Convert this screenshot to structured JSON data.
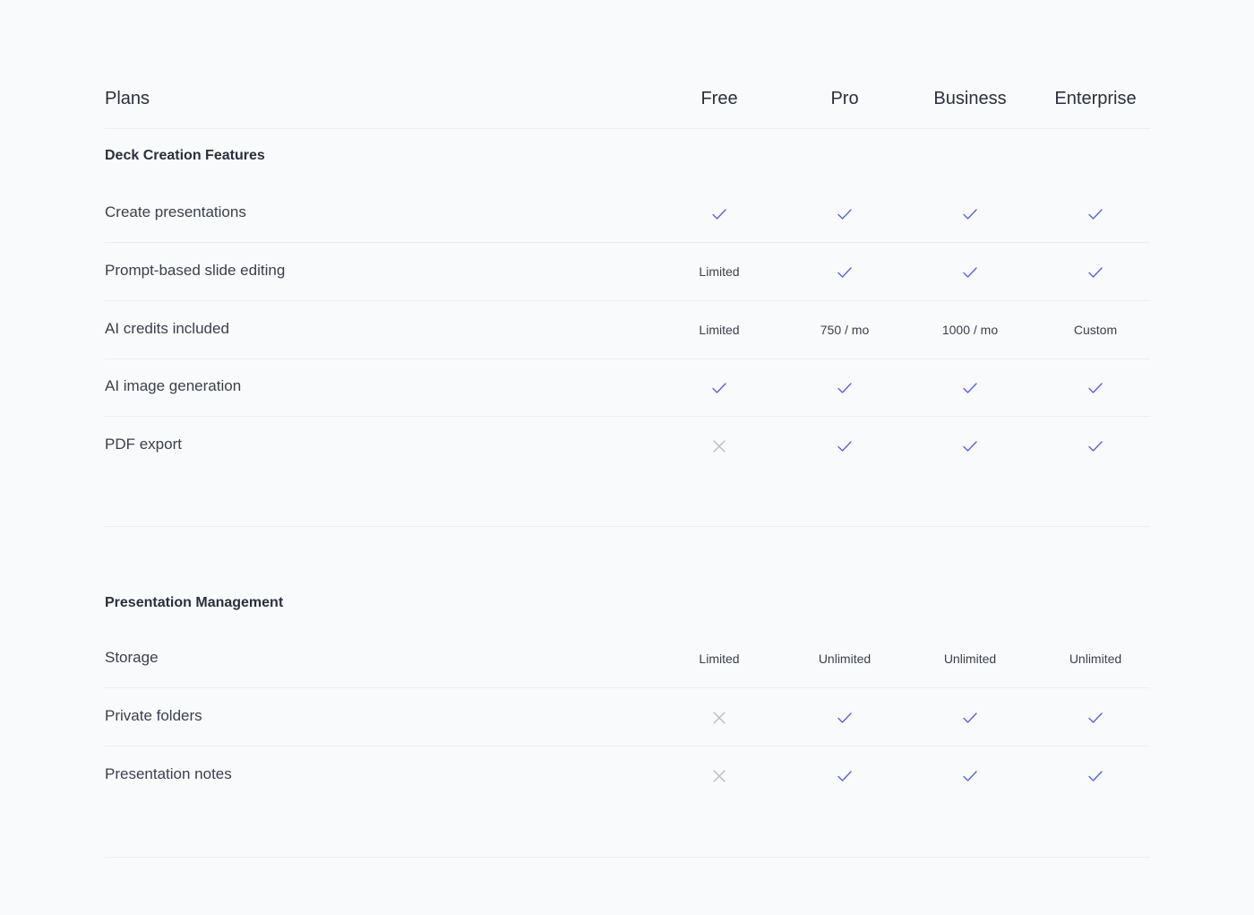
{
  "header": {
    "plans_label": "Plans",
    "plans": [
      "Free",
      "Pro",
      "Business",
      "Enterprise"
    ]
  },
  "sections": [
    {
      "title": "Deck Creation Features",
      "rows": [
        {
          "feature": "Create presentations",
          "cells": [
            {
              "type": "check"
            },
            {
              "type": "check"
            },
            {
              "type": "check"
            },
            {
              "type": "check"
            }
          ]
        },
        {
          "feature": "Prompt-based slide editing",
          "cells": [
            {
              "type": "text",
              "value": "Limited"
            },
            {
              "type": "check"
            },
            {
              "type": "check"
            },
            {
              "type": "check"
            }
          ]
        },
        {
          "feature": "AI credits included",
          "cells": [
            {
              "type": "text",
              "value": "Limited"
            },
            {
              "type": "text",
              "value": "750 / mo"
            },
            {
              "type": "text",
              "value": "1000 / mo"
            },
            {
              "type": "text",
              "value": "Custom"
            }
          ]
        },
        {
          "feature": "AI image generation",
          "cells": [
            {
              "type": "check"
            },
            {
              "type": "check"
            },
            {
              "type": "check"
            },
            {
              "type": "check"
            }
          ]
        },
        {
          "feature": "PDF export",
          "cells": [
            {
              "type": "cross"
            },
            {
              "type": "check"
            },
            {
              "type": "check"
            },
            {
              "type": "check"
            }
          ]
        }
      ]
    },
    {
      "title": "Presentation Management",
      "rows": [
        {
          "feature": "Storage",
          "cells": [
            {
              "type": "text",
              "value": "Limited"
            },
            {
              "type": "text",
              "value": "Unlimited"
            },
            {
              "type": "text",
              "value": "Unlimited"
            },
            {
              "type": "text",
              "value": "Unlimited"
            }
          ]
        },
        {
          "feature": "Private folders",
          "cells": [
            {
              "type": "cross"
            },
            {
              "type": "check"
            },
            {
              "type": "check"
            },
            {
              "type": "check"
            }
          ]
        },
        {
          "feature": "Presentation notes",
          "cells": [
            {
              "type": "cross"
            },
            {
              "type": "check"
            },
            {
              "type": "check"
            },
            {
              "type": "check"
            }
          ]
        }
      ]
    }
  ],
  "icons": {
    "included": "check-icon",
    "not_included": "cross-icon"
  },
  "colors": {
    "background": "#f9fafc",
    "check": "#5a63d8",
    "cross": "#b9bdc8",
    "divider": "#eceef3",
    "text": "#2b2f3d"
  }
}
